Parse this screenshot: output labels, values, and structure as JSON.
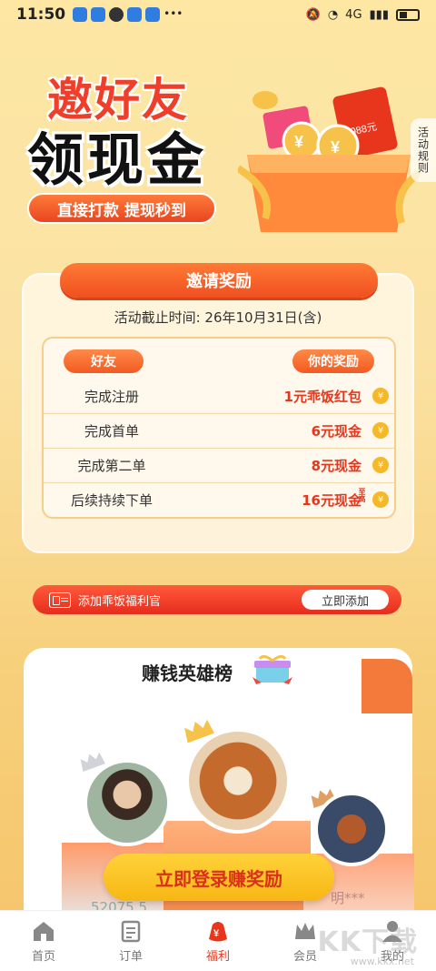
{
  "status_bar": {
    "time": "11:50",
    "network": "4G"
  },
  "hero": {
    "title_line1": "邀好友",
    "title_line2": "领现金",
    "slogan": "直接打款 提现秒到",
    "rules_tab": "活动规则",
    "gift_amount": "59988元"
  },
  "invite": {
    "header": "邀请奖励",
    "deadline": "活动截止时间: 26年10月31日(含)",
    "col_friend": "好友",
    "col_reward": "你的奖励",
    "rows": [
      {
        "task": "完成注册",
        "reward": "1元乖饭红包"
      },
      {
        "task": "完成首单",
        "reward": "6元现金"
      },
      {
        "task": "完成第二单",
        "reward": "8元现金"
      },
      {
        "task": "后续持续下单",
        "reward": "16元现金",
        "note": "至高"
      }
    ],
    "coin_symbol": "¥"
  },
  "welfare": {
    "text": "添加乖饭福利官",
    "button": "立即添加"
  },
  "leaderboard": {
    "title": "赚钱英雄榜",
    "second_score": "52075.5",
    "third_name": "明***",
    "login_button": "立即登录赚奖励"
  },
  "tab_bar": {
    "tabs": [
      {
        "label": "首页",
        "icon": "home-icon",
        "active": false
      },
      {
        "label": "订单",
        "icon": "order-icon",
        "active": false
      },
      {
        "label": "福利",
        "icon": "welfare-icon",
        "active": true
      },
      {
        "label": "会员",
        "icon": "crown-icon",
        "active": false
      },
      {
        "label": "我的",
        "icon": "user-icon",
        "active": false
      }
    ]
  },
  "watermark": {
    "text": "KK下载",
    "url": "www.kkx.net"
  },
  "colors": {
    "accent": "#e8361d",
    "orange": "#f25a22",
    "gold": "#f7b714",
    "background": "#fde7a3"
  }
}
